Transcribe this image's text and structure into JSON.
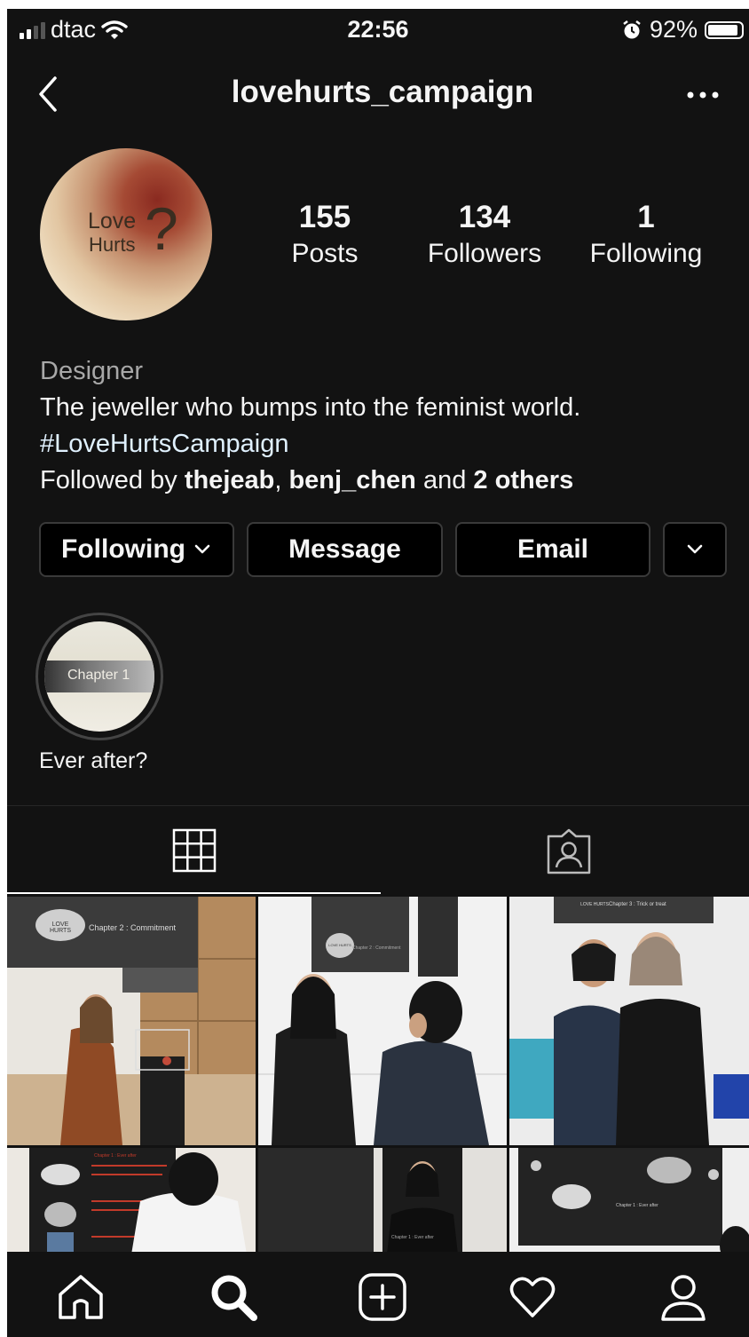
{
  "status_bar": {
    "carrier": "dtac",
    "time": "22:56",
    "battery": "92%",
    "battery_level": 0.92
  },
  "header": {
    "username": "lovehurts_campaign"
  },
  "profile": {
    "avatar_text_1": "Love",
    "avatar_text_2": "Hurts",
    "avatar_mark": "?",
    "stats": [
      {
        "value": "155",
        "label": "Posts"
      },
      {
        "value": "134",
        "label": "Followers"
      },
      {
        "value": "1",
        "label": "Following"
      }
    ],
    "category": "Designer",
    "bio": "The jeweller who bumps into the feminist world.",
    "hashtag": "#LoveHurtsCampaign",
    "followed_prefix": "Followed by ",
    "followed_user_1": "thejeab",
    "followed_sep": ", ",
    "followed_user_2": "benj_chen",
    "followed_and": " and ",
    "followed_others": "2 others"
  },
  "actions": {
    "following": "Following",
    "message": "Message",
    "email": "Email"
  },
  "highlight": {
    "cover_text": "Chapter 1",
    "label": "Ever after?"
  },
  "grid_posts": [
    {
      "caption": "Chapter 2 : Commitment",
      "badge": "LOVE HURTS"
    },
    {
      "caption": "Chapter 2 : Commitment",
      "badge": "LOVE HURTS"
    },
    {
      "caption": "Chapter 3 : Trick or treat",
      "badge": "LOVE HURTS"
    },
    {
      "caption": "Chapter 1 : Ever after",
      "badge": ""
    },
    {
      "caption": "Chapter 1 : Ever after",
      "badge": ""
    },
    {
      "caption": "Chapter 1 : Ever after",
      "badge": ""
    }
  ],
  "icons": {
    "back": "chevron-left-icon",
    "more": "more-horizontal-icon",
    "grid_tab": "grid-icon",
    "tagged_tab": "tagged-person-icon",
    "nav": [
      "home-icon",
      "search-icon",
      "add-post-icon",
      "heart-icon",
      "profile-icon"
    ]
  }
}
